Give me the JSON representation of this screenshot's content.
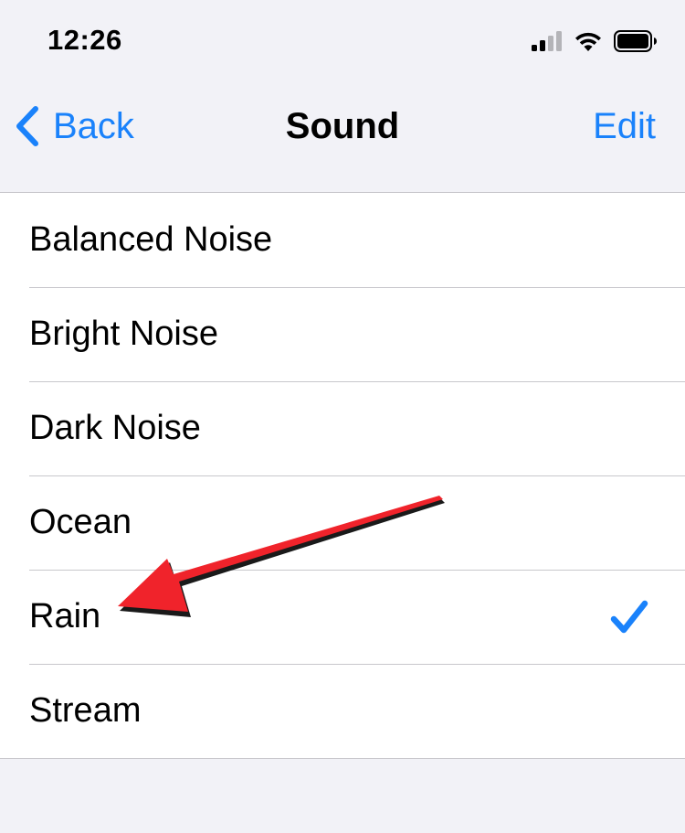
{
  "status_bar": {
    "time": "12:26"
  },
  "nav": {
    "back_label": "Back",
    "title": "Sound",
    "edit_label": "Edit"
  },
  "sounds": {
    "items": [
      {
        "label": "Balanced Noise",
        "selected": false
      },
      {
        "label": "Bright Noise",
        "selected": false
      },
      {
        "label": "Dark Noise",
        "selected": false
      },
      {
        "label": "Ocean",
        "selected": false
      },
      {
        "label": "Rain",
        "selected": true
      },
      {
        "label": "Stream",
        "selected": false
      }
    ]
  },
  "colors": {
    "accent": "#1a82fb",
    "background": "#f2f2f7",
    "annotation_arrow": "#f0232b"
  },
  "icons": {
    "signal": "cellular-signal-icon",
    "wifi": "wifi-icon",
    "battery": "battery-icon",
    "back": "chevron-left-icon",
    "selected": "checkmark-icon"
  }
}
